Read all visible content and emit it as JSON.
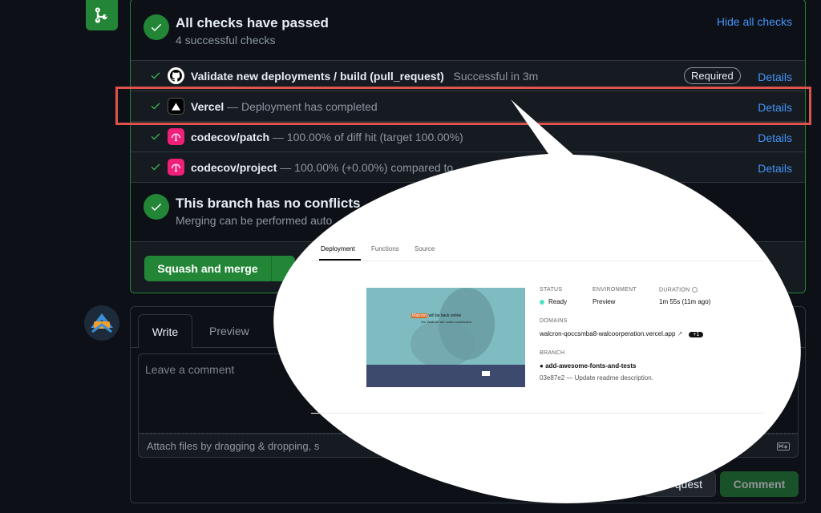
{
  "merge": {
    "title": "All checks have passed",
    "subtitle": "4 successful checks",
    "hide_link": "Hide all checks",
    "checks": [
      {
        "name": "Validate new deployments / build (pull_request)",
        "desc": "Successful in 3m",
        "badge": "Required",
        "details": "Details",
        "logo": "github-icon"
      },
      {
        "name": "Vercel",
        "desc": "— Deployment has completed",
        "details": "Details",
        "logo": "vercel-icon"
      },
      {
        "name": "codecov/patch",
        "desc": "— 100.00% of diff hit (target 100.00%)",
        "details": "Details",
        "logo": "codecov-icon"
      },
      {
        "name": "codecov/project",
        "desc": "— 100.00% (+0.00%) compared to",
        "details": "Details",
        "logo": "codecov-icon"
      }
    ],
    "conflict_title": "This branch has no conflicts",
    "conflict_sub": "Merging can be performed auto",
    "squash_label": "Squash and merge"
  },
  "comment": {
    "tab_write": "Write",
    "tab_preview": "Preview",
    "placeholder": "Leave a comment",
    "attach": "Attach files by dragging & dropping, s",
    "close_label": "quest",
    "comment_label": "Comment"
  },
  "vercel": {
    "tabs": [
      "Deployment",
      "Functions",
      "Source"
    ],
    "status_label": "STATUS",
    "status_value": "Ready",
    "env_label": "ENVIRONMENT",
    "env_value": "Preview",
    "duration_label": "DURATION",
    "duration_value": "1m 55s (11m ago)",
    "domains_label": "DOMAINS",
    "domain_value": "walcron-qoccsmba8-walcoorperation.vercel.app",
    "domain_badge": "+1",
    "branch_label": "BRANCH",
    "branch_value": "add-awesome-fonts-and-tests",
    "commit_value": "03e87e2 — Update readme description.",
    "preview": {
      "brand": "Walcron",
      "headline": "will be back online",
      "tagline": "Our Walk we are under construction"
    }
  },
  "colors": {
    "accent_green": "#238636",
    "link_blue": "#4493f8",
    "highlight_red": "#e0524c",
    "ready_green": "#50e3c2"
  }
}
